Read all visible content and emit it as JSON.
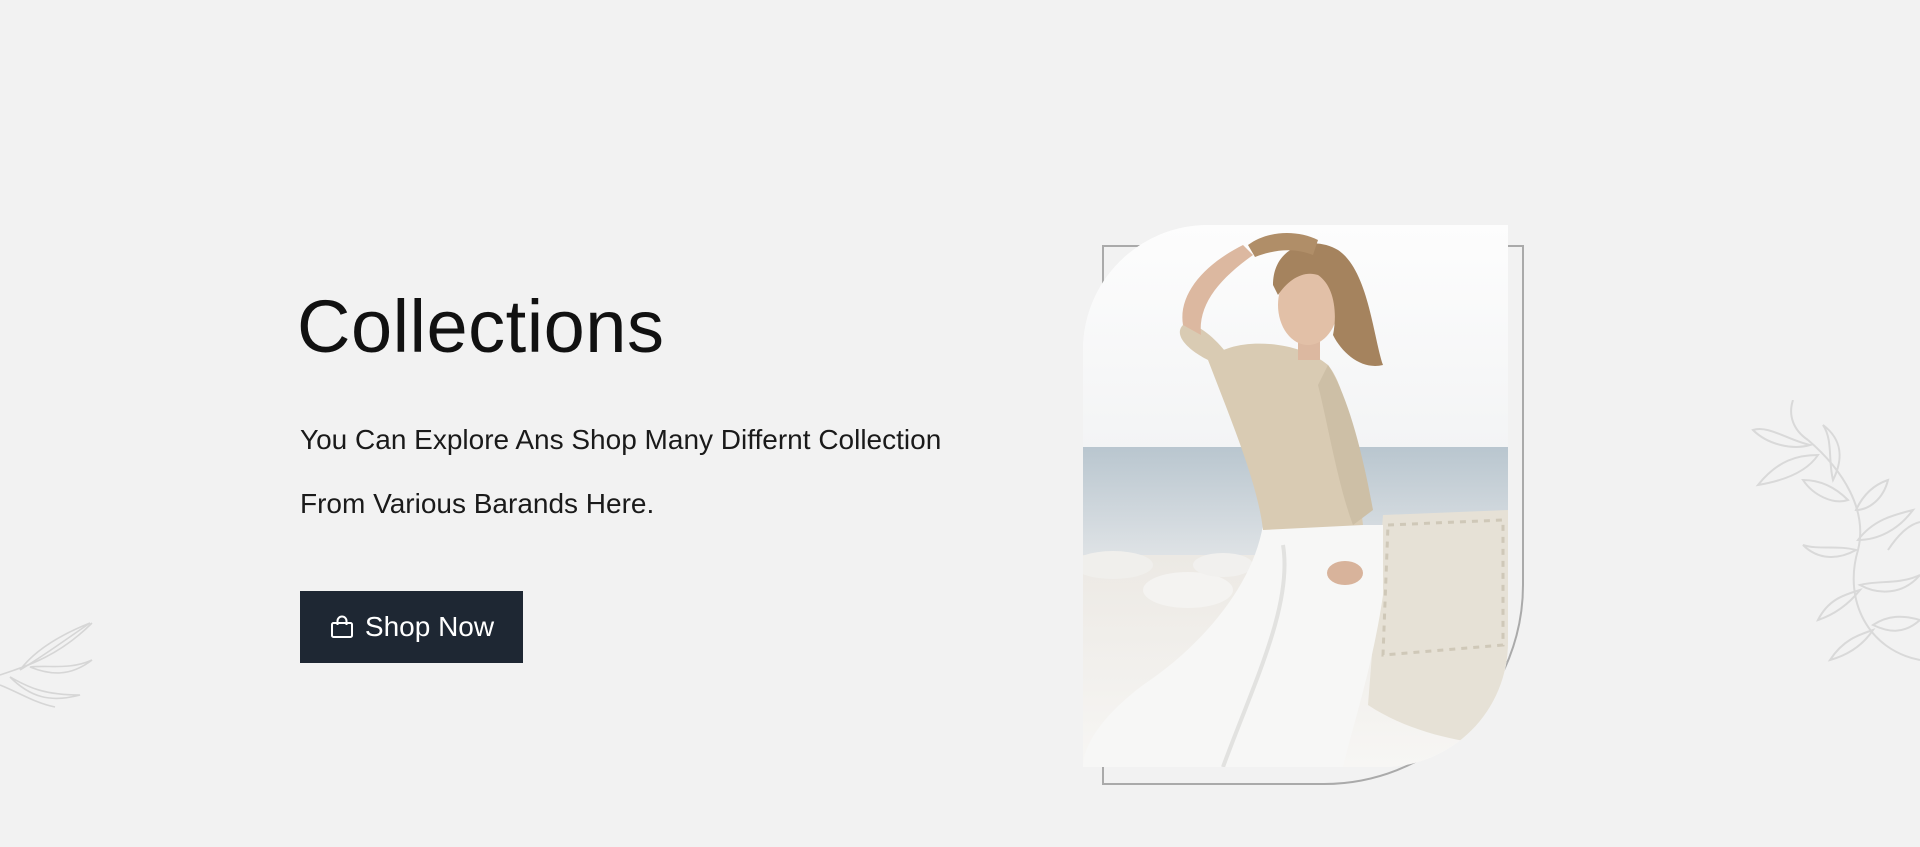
{
  "hero": {
    "title": "Collections",
    "description_line1": "You Can Explore Ans Shop Many Differnt Collection",
    "description_line2": "From Various Barands Here.",
    "shop_button_label": "Shop Now",
    "shop_button_icon": "shopping-bag-icon"
  },
  "image": {
    "alt": "Woman in beige blouse and white pants leaning on a chair by the sea",
    "decoration": "frame-outline"
  },
  "decorations": {
    "left": "leaf-branch-icon",
    "right": "leaf-vine-icon"
  },
  "colors": {
    "background": "#f2f2f2",
    "button_bg": "#1e2733",
    "button_text": "#ffffff",
    "heading": "#111111",
    "frame": "#aaaaaa"
  }
}
